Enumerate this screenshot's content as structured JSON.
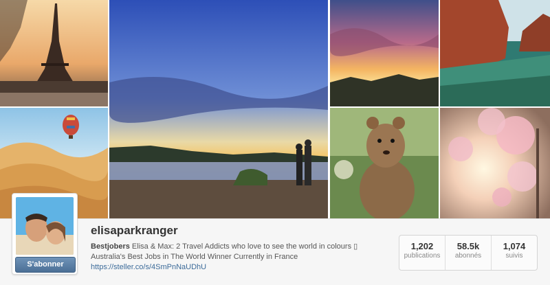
{
  "photos": [
    {
      "subject": "eiffel-tower"
    },
    {
      "subject": "desert-balloon"
    },
    {
      "subject": "couple-lake-sunset"
    },
    {
      "subject": "mountain-sunset"
    },
    {
      "subject": "red-cliffs-sea"
    },
    {
      "subject": "quokka"
    },
    {
      "subject": "cherry-blossom"
    }
  ],
  "profile": {
    "username": "elisaparkranger",
    "bio_name": "Bestjobers",
    "bio_line1": "Elisa & Max: 2 Travel Addicts who love to see the world in colours ▯",
    "bio_line2": "Australia's Best Jobs in The World Winner Currently in France",
    "link": "https://steller.co/s/4SmPnNaUDhU",
    "follow_label": "S'abonner"
  },
  "stats": [
    {
      "value": "1,202",
      "label": "publications"
    },
    {
      "value": "58.5k",
      "label": "abonnés"
    },
    {
      "value": "1,074",
      "label": "suivis"
    }
  ],
  "colors": {
    "button": "#5a7fa6",
    "link": "#3b6a99"
  }
}
